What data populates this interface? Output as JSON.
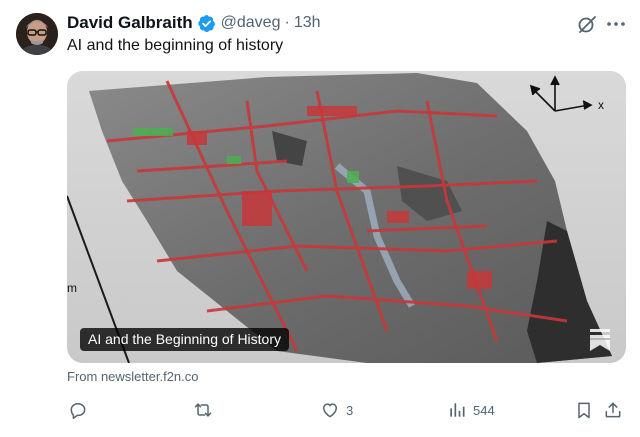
{
  "author": {
    "display_name": "David Galbraith",
    "handle": "@daveg",
    "separator": "·",
    "time": "13h",
    "verified_icon": "verified-badge-icon",
    "avatar": "avatar"
  },
  "tweet": {
    "text": "AI and the beginning of history"
  },
  "media": {
    "caption": "AI and the Beginning of History",
    "axis_x_label": "x",
    "edge_label": "m"
  },
  "card": {
    "source": "From newsletter.f2n.co"
  },
  "actions": {
    "reply_icon": "reply-icon",
    "repost_icon": "repost-icon",
    "like_icon": "like-icon",
    "like_count": "3",
    "views_icon": "views-icon",
    "views_count": "544",
    "bookmark_icon": "bookmark-icon",
    "share_icon": "share-icon"
  },
  "colors": {
    "text": "#0f1419",
    "secondary": "#536471",
    "verified": "#1d9bf0",
    "terrain_red": "#c8373a"
  }
}
